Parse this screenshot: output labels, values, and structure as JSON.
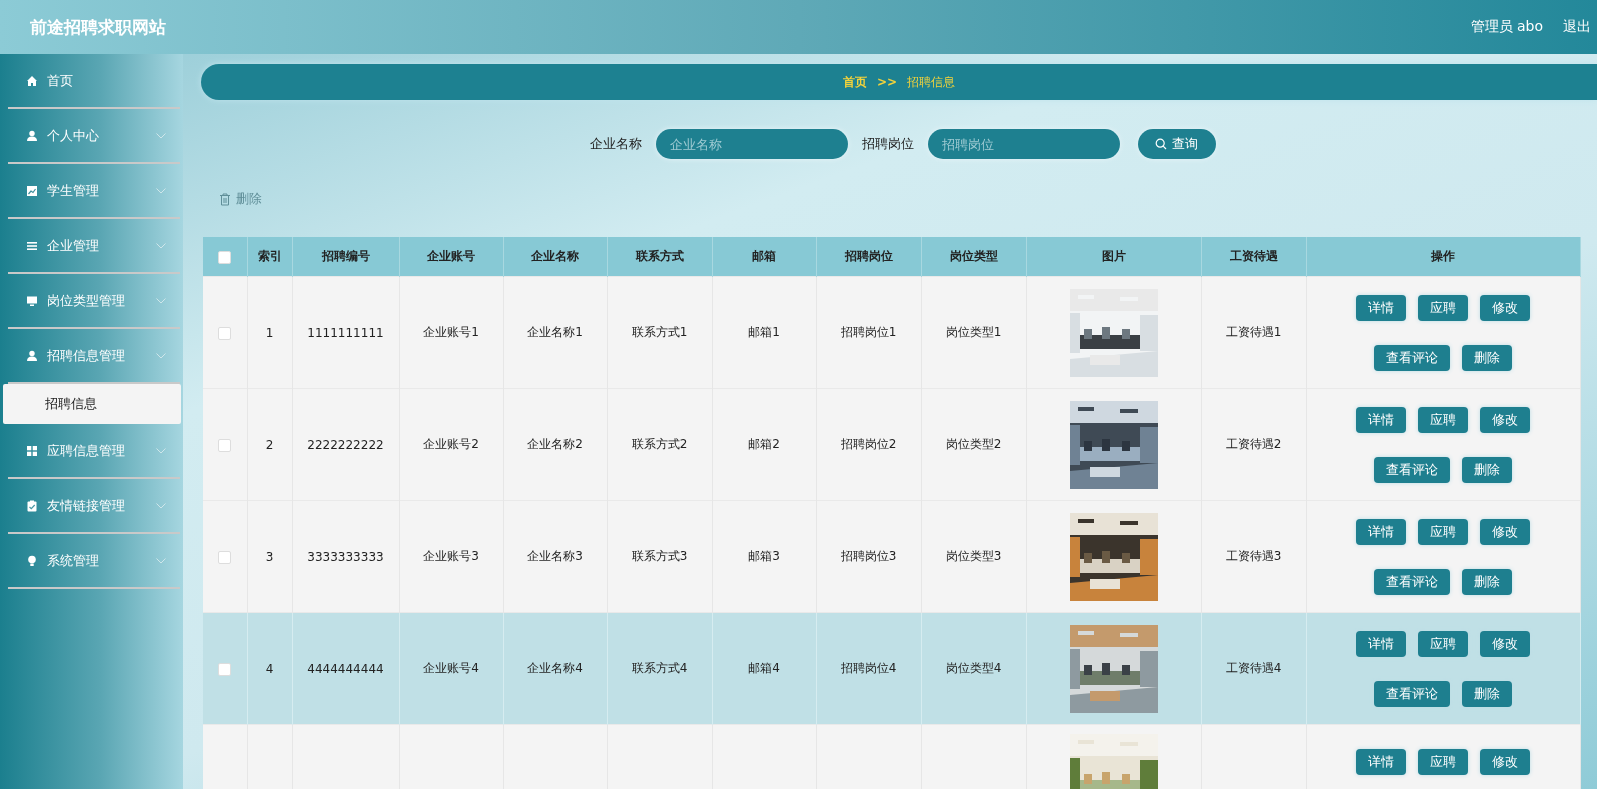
{
  "header": {
    "site_title": "前途招聘求职网站",
    "user": "管理员 abo",
    "logout": "退出"
  },
  "sidebar": {
    "items": [
      {
        "label": "首页",
        "has_arrow": false
      },
      {
        "label": "个人中心",
        "has_arrow": true
      },
      {
        "label": "学生管理",
        "has_arrow": true
      },
      {
        "label": "企业管理",
        "has_arrow": true
      },
      {
        "label": "岗位类型管理",
        "has_arrow": true
      },
      {
        "label": "招聘信息管理",
        "has_arrow": true,
        "expanded": true,
        "children": [
          {
            "label": "招聘信息",
            "selected": true
          }
        ]
      },
      {
        "label": "应聘信息管理",
        "has_arrow": true
      },
      {
        "label": "友情链接管理",
        "has_arrow": true
      },
      {
        "label": "系统管理",
        "has_arrow": true
      }
    ]
  },
  "breadcrumb": {
    "home": "首页",
    "separator": ">>",
    "current": "招聘信息"
  },
  "search": {
    "fields": [
      {
        "label": "企业名称",
        "placeholder": "企业名称"
      },
      {
        "label": "招聘岗位",
        "placeholder": "招聘岗位"
      }
    ],
    "button": "查询"
  },
  "toolbar": {
    "delete": "删除",
    "disabled": true
  },
  "table": {
    "header_checked": false,
    "columns": [
      "索引",
      "招聘编号",
      "企业账号",
      "企业名称",
      "联系方式",
      "邮箱",
      "招聘岗位",
      "岗位类型",
      "图片",
      "工资待遇",
      "操作"
    ],
    "rows": [
      {
        "checked": false,
        "highlighted": false,
        "cells": [
          "1",
          "1111111111",
          "企业账号1",
          "企业名称1",
          "联系方式1",
          "邮箱1",
          "招聘岗位1",
          "岗位类型1",
          null,
          "工资待遇1"
        ],
        "image": {
          "kind": "picture"
        },
        "actions": [
          "详情",
          "应聘",
          "修改",
          "查看评论",
          "删除"
        ]
      },
      {
        "checked": false,
        "highlighted": false,
        "cells": [
          "2",
          "2222222222",
          "企业账号2",
          "企业名称2",
          "联系方式2",
          "邮箱2",
          "招聘岗位2",
          "岗位类型2",
          null,
          "工资待遇2"
        ],
        "image": {
          "kind": "picture"
        },
        "actions": [
          "详情",
          "应聘",
          "修改",
          "查看评论",
          "删除"
        ]
      },
      {
        "checked": false,
        "highlighted": false,
        "cells": [
          "3",
          "3333333333",
          "企业账号3",
          "企业名称3",
          "联系方式3",
          "邮箱3",
          "招聘岗位3",
          "岗位类型3",
          null,
          "工资待遇3"
        ],
        "image": {
          "kind": "picture"
        },
        "actions": [
          "详情",
          "应聘",
          "修改",
          "查看评论",
          "删除"
        ]
      },
      {
        "checked": false,
        "highlighted": true,
        "cells": [
          "4",
          "4444444444",
          "企业账号4",
          "企业名称4",
          "联系方式4",
          "邮箱4",
          "招聘岗位4",
          "岗位类型4",
          null,
          "工资待遇4"
        ],
        "image": {
          "kind": "picture"
        },
        "actions": [
          "详情",
          "应聘",
          "修改",
          "查看评论",
          "删除"
        ]
      },
      {
        "highlighted": false,
        "image": {
          "kind": "picture"
        },
        "actions": [
          "详情",
          "应聘",
          "修改"
        ]
      }
    ]
  }
}
